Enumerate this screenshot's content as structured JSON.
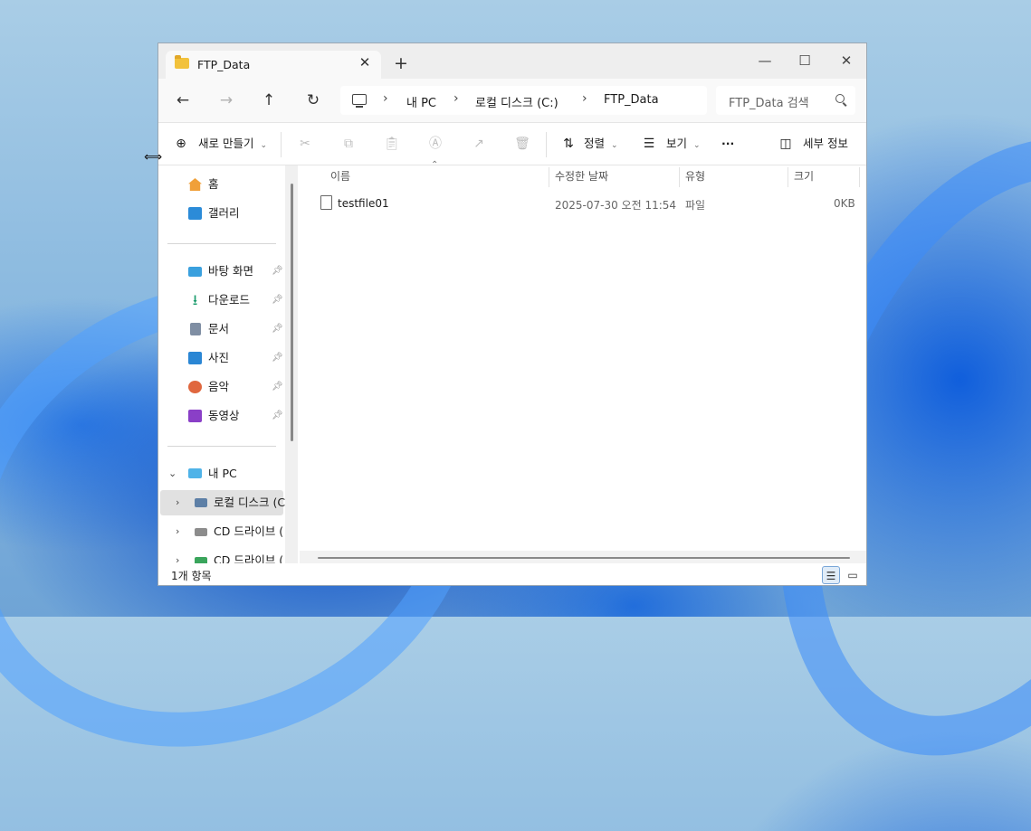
{
  "window": {
    "tab_title": "FTP_Data",
    "new_tab": "+",
    "close_tab": "✕",
    "minimize": "—",
    "maximize": "☐",
    "close": "✕"
  },
  "nav": {
    "back": "←",
    "forward": "→",
    "up": "↑",
    "refresh": "↻",
    "breadcrumb": [
      "내 PC",
      "로컬 디스크 (C:)",
      "FTP_Data"
    ],
    "separator": "›",
    "search_placeholder": "FTP_Data 검색"
  },
  "toolbar": {
    "new_label": "새로 만들기",
    "sort_label": "정렬",
    "view_label": "보기",
    "more_label": "···",
    "details_label": "세부 정보"
  },
  "sidebar": {
    "home": "홈",
    "gallery": "갤러리",
    "quick": [
      {
        "label": "바탕 화면",
        "icon": "desktop-icon"
      },
      {
        "label": "다운로드",
        "icon": "download-icon"
      },
      {
        "label": "문서",
        "icon": "document-icon"
      },
      {
        "label": "사진",
        "icon": "picture-icon"
      },
      {
        "label": "음악",
        "icon": "music-icon"
      },
      {
        "label": "동영상",
        "icon": "video-icon"
      }
    ],
    "this_pc": "내 PC",
    "drives": [
      "로컬 디스크 (C",
      "CD 드라이브 (",
      "CD 드라이브 ("
    ]
  },
  "columns": {
    "name": "이름",
    "modified": "수정한 날짜",
    "type": "유형",
    "size": "크기"
  },
  "files": [
    {
      "name": "testfile01",
      "modified": "2025-07-30 오전 11:54",
      "type": "파일",
      "size": "0KB"
    }
  ],
  "status": {
    "count": "1개 항목"
  }
}
